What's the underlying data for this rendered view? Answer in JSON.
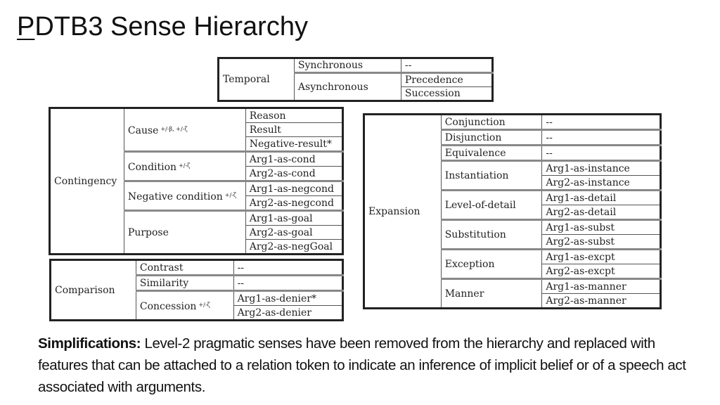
{
  "title": {
    "first_letter": "P",
    "rest": "DTB3 Sense Hierarchy"
  },
  "temporal": {
    "label": "Temporal",
    "level2": [
      {
        "label": "Synchronous",
        "level3": [
          "--"
        ]
      },
      {
        "label": "Asynchronous",
        "level3": [
          "Precedence",
          "Succession"
        ]
      }
    ]
  },
  "contingency": {
    "label": "Contingency",
    "level2": [
      {
        "label": "Cause",
        "features": "+/-β, +/-ζ",
        "level3": [
          "Reason",
          "Result",
          "Negative-result*"
        ]
      },
      {
        "label": "Condition",
        "features": "+/-ζ",
        "level3": [
          "Arg1-as-cond",
          "Arg2-as-cond"
        ]
      },
      {
        "label": "Negative condition",
        "features": "+/-ζ",
        "level3": [
          "Arg1-as-negcond",
          "Arg2-as-negcond"
        ]
      },
      {
        "label": "Purpose",
        "level3": [
          "Arg1-as-goal",
          "Arg2-as-goal",
          "Arg2-as-negGoal"
        ]
      }
    ]
  },
  "comparison": {
    "label": "Comparison",
    "level2": [
      {
        "label": "Contrast",
        "level3": [
          "--"
        ]
      },
      {
        "label": "Similarity",
        "level3": [
          "--"
        ]
      },
      {
        "label": "Concession",
        "features": "+/-ζ",
        "level3": [
          "Arg1-as-denier*",
          "Arg2-as-denier"
        ]
      }
    ]
  },
  "expansion": {
    "label": "Expansion",
    "level2": [
      {
        "label": "Conjunction",
        "level3": [
          "--"
        ]
      },
      {
        "label": "Disjunction",
        "level3": [
          "--"
        ]
      },
      {
        "label": "Equivalence",
        "level3": [
          "--"
        ]
      },
      {
        "label": "Instantiation",
        "level3": [
          "Arg1-as-instance",
          "Arg2-as-instance"
        ]
      },
      {
        "label": "Level-of-detail",
        "level3": [
          "Arg1-as-detail",
          "Arg2-as-detail"
        ]
      },
      {
        "label": "Substitution",
        "level3": [
          "Arg1-as-subst",
          "Arg2-as-subst"
        ]
      },
      {
        "label": "Exception",
        "level3": [
          "Arg1-as-excpt",
          "Arg2-as-excpt"
        ]
      },
      {
        "label": "Manner",
        "level3": [
          "Arg1-as-manner",
          "Arg2-as-manner"
        ]
      }
    ]
  },
  "note": {
    "bold": "Simplifications:",
    "text": " Level-2 pragmatic senses have been removed from the hierarchy and replaced with features that can be attached to a relation token to indicate an inference of implicit belief or of a speech act associated with arguments."
  }
}
